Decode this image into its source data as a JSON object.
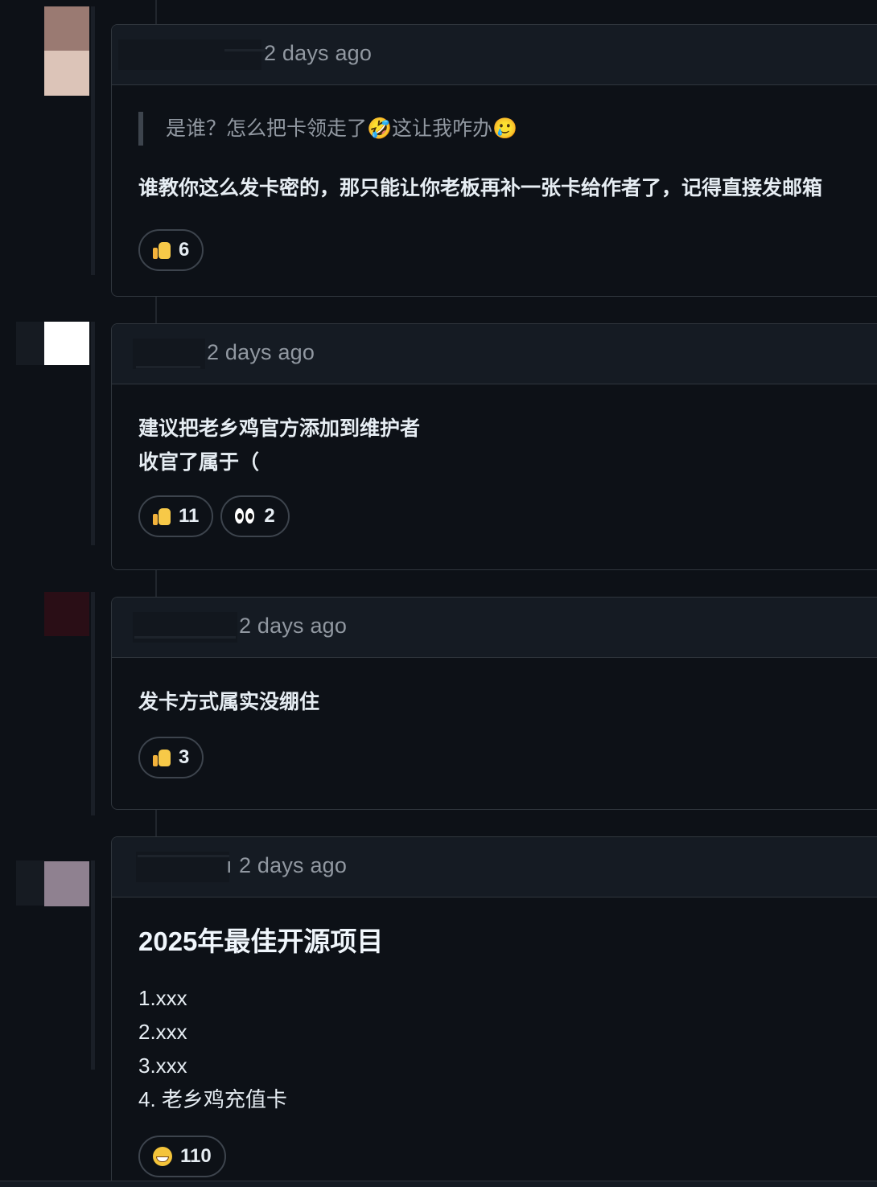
{
  "comments": [
    {
      "timestamp": "2 days ago",
      "avatar_colors": [
        "#9a7a72",
        "#dcc4b8"
      ],
      "quote": "是谁？怎么把卡领走了🤣这让我咋办🥲",
      "body": "谁教你这么发卡密的，那只能让你老板再补一张卡给作者了，记得直接发邮箱",
      "reactions": [
        {
          "icon": "thumbs-up-icon",
          "count": "6"
        }
      ]
    },
    {
      "timestamp": "2 days ago",
      "avatar_colors": [
        "#ffffff"
      ],
      "body_lines": [
        "建议把老乡鸡官方添加到维护者",
        "收官了属于（"
      ],
      "reactions": [
        {
          "icon": "thumbs-up-icon",
          "count": "11"
        },
        {
          "icon": "eyes-icon",
          "count": "2"
        }
      ]
    },
    {
      "timestamp": "2 days ago",
      "avatar_colors": [
        "#2a0e16"
      ],
      "body": "发卡方式属实没绷住",
      "reactions": [
        {
          "icon": "thumbs-up-icon",
          "count": "3"
        }
      ]
    },
    {
      "timestamp": "2 days ago",
      "author_fragment": "ı",
      "avatar_colors": [
        "#8f8190"
      ],
      "heading": "2025年最佳开源项目",
      "list": [
        "1.xxx",
        "2.xxx",
        "3.xxx",
        "4. 老乡鸡充值卡"
      ],
      "reactions": [
        {
          "icon": "grinning-face-icon",
          "count": "110"
        }
      ]
    }
  ]
}
